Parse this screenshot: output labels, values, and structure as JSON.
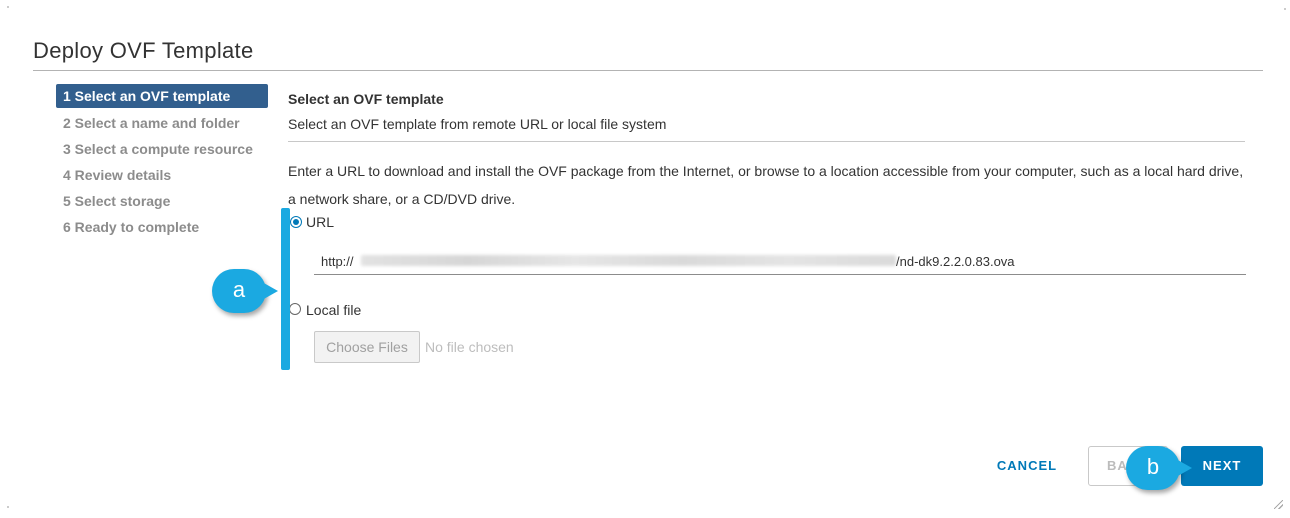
{
  "dialog": {
    "title": "Deploy OVF Template"
  },
  "steps": [
    {
      "label": "1 Select an OVF template",
      "state": "active"
    },
    {
      "label": "2 Select a name and folder",
      "state": "disabled"
    },
    {
      "label": "3 Select a compute resource",
      "state": "disabled"
    },
    {
      "label": "4 Review details",
      "state": "disabled"
    },
    {
      "label": "5 Select storage",
      "state": "disabled"
    },
    {
      "label": "6 Ready to complete",
      "state": "disabled"
    }
  ],
  "content": {
    "title": "Select an OVF template",
    "subtitle": "Select an OVF template from remote URL or local file system",
    "description": "Enter a URL to download and install the OVF package from the Internet, or browse to a location accessible from your computer, such as a local hard drive, a network share, or a CD/DVD drive.",
    "url_option": {
      "label": "URL",
      "selected": true
    },
    "url_value": {
      "prefix": "http://",
      "suffix": "/nd-dk9.2.2.0.83.ova"
    },
    "local_option": {
      "label": "Local file",
      "selected": false
    },
    "choose_files_label": "Choose Files",
    "file_status": "No file chosen"
  },
  "footer": {
    "cancel_label": "CANCEL",
    "back_label": "BA",
    "next_label": "NEXT"
  },
  "annotations": {
    "a": "a",
    "b": "b"
  },
  "colors": {
    "accent": "#0079b8",
    "active_step": "#325f8e",
    "callout": "#1ba9e1"
  }
}
